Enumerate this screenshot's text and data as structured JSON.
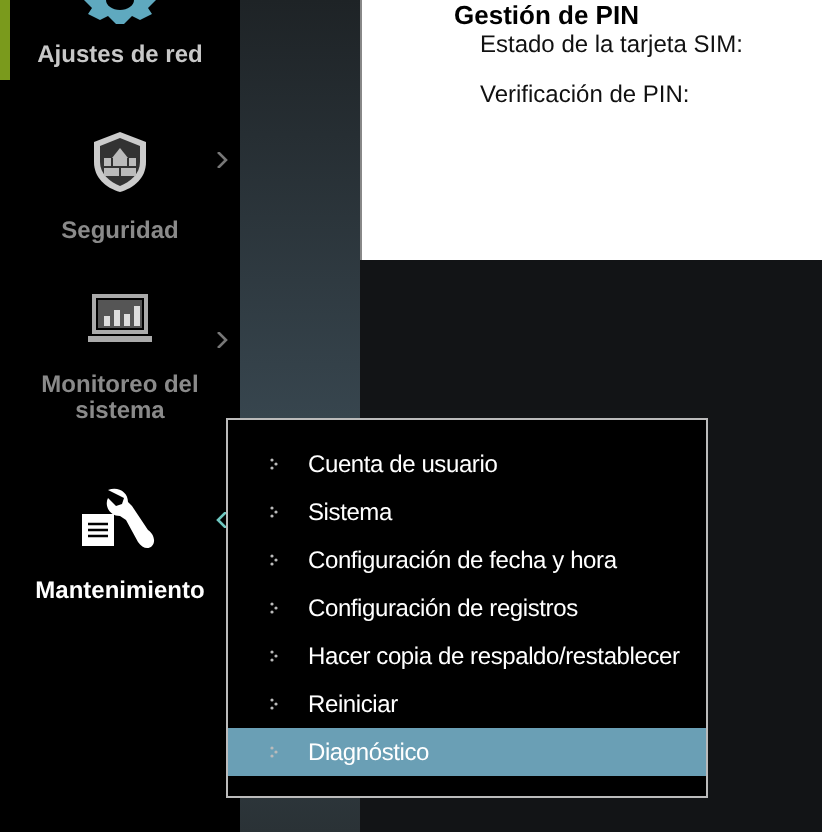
{
  "sidebar": {
    "items": [
      {
        "label": "Ajustes de red",
        "selected": true,
        "expanded": false,
        "submenu": false
      },
      {
        "label": "Seguridad",
        "selected": false,
        "expanded": false,
        "submenu": true
      },
      {
        "label": "Monitoreo del sistema",
        "selected": false,
        "expanded": false,
        "submenu": true
      },
      {
        "label": "Mantenimiento",
        "selected": false,
        "expanded": true,
        "submenu": true
      }
    ]
  },
  "panel": {
    "heading": "Gestión de PIN",
    "fields": [
      {
        "label": "Estado de la tarjeta SIM:"
      },
      {
        "label": "Verificación de PIN:"
      }
    ]
  },
  "submenu": {
    "items": [
      {
        "label": "Cuenta de usuario",
        "selected": false
      },
      {
        "label": "Sistema",
        "selected": false
      },
      {
        "label": "Configuración de fecha y hora",
        "selected": false
      },
      {
        "label": "Configuración de registros",
        "selected": false
      },
      {
        "label": "Hacer copia de respaldo/restablecer",
        "selected": false
      },
      {
        "label": "Reiniciar",
        "selected": false
      },
      {
        "label": "Diagnóstico",
        "selected": true
      }
    ]
  }
}
